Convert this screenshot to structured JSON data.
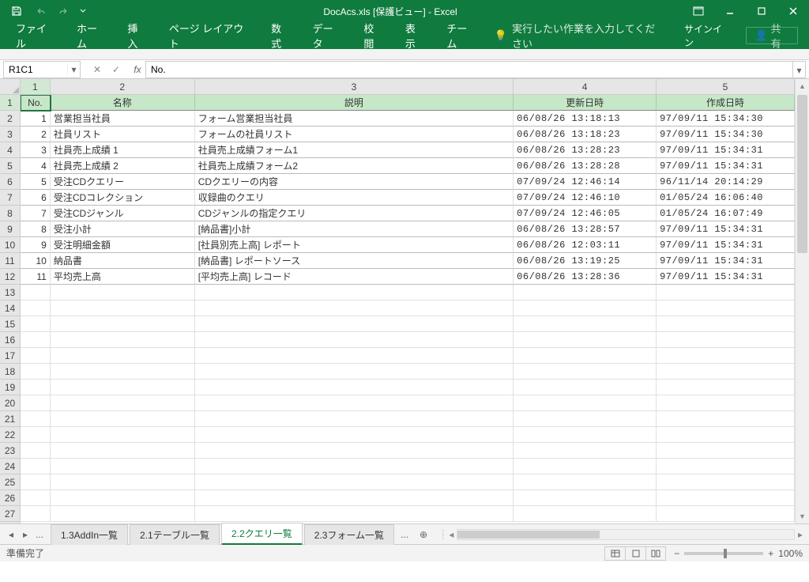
{
  "window": {
    "title": "DocAcs.xls  [保護ビュー] - Excel"
  },
  "ribbon": {
    "tabs": [
      "ファイル",
      "ホーム",
      "挿入",
      "ページ レイアウト",
      "数式",
      "データ",
      "校閲",
      "表示",
      "チーム"
    ],
    "tell_me": "実行したい作業を入力してください",
    "signin": "サインイン",
    "share": "共有"
  },
  "formula_bar": {
    "name_box": "R1C1",
    "formula": "No."
  },
  "columns": {
    "labels": [
      "1",
      "2",
      "3",
      "4",
      "5"
    ],
    "widths": [
      38,
      184,
      406,
      182,
      176
    ]
  },
  "headers": [
    "No.",
    "名称",
    "説明",
    "更新日時",
    "作成日時"
  ],
  "rows": [
    {
      "no": "1",
      "name": "営業担当社員",
      "desc": "フォーム営業担当社員",
      "upd": "06/08/26 13:18:13",
      "crt": "97/09/11 15:34:30"
    },
    {
      "no": "2",
      "name": "社員リスト",
      "desc": "フォームの社員リスト",
      "upd": "06/08/26 13:18:23",
      "crt": "97/09/11 15:34:30"
    },
    {
      "no": "3",
      "name": "社員売上成績 1",
      "desc": "社員売上成績フォーム1",
      "upd": "06/08/26 13:28:23",
      "crt": "97/09/11 15:34:31"
    },
    {
      "no": "4",
      "name": "社員売上成績 2",
      "desc": "社員売上成績フォーム2",
      "upd": "06/08/26 13:28:28",
      "crt": "97/09/11 15:34:31"
    },
    {
      "no": "5",
      "name": "受注CDクエリー",
      "desc": "CDクエリーの内容",
      "upd": "07/09/24 12:46:14",
      "crt": "96/11/14 20:14:29"
    },
    {
      "no": "6",
      "name": "受注CDコレクション",
      "desc": "収録曲のクエリ",
      "upd": "07/09/24 12:46:10",
      "crt": "01/05/24 16:06:40"
    },
    {
      "no": "7",
      "name": "受注CDジャンル",
      "desc": "CDジャンルの指定クエリ",
      "upd": "07/09/24 12:46:05",
      "crt": "01/05/24 16:07:49"
    },
    {
      "no": "8",
      "name": "受注小計",
      "desc": "[納品書]小計",
      "upd": "06/08/26 13:28:57",
      "crt": "97/09/11 15:34:31"
    },
    {
      "no": "9",
      "name": "受注明細金額",
      "desc": "[社員別売上高] レポート",
      "upd": "06/08/26 12:03:11",
      "crt": "97/09/11 15:34:31"
    },
    {
      "no": "10",
      "name": "納品書",
      "desc": "[納品書] レポートソース",
      "upd": "06/08/26 13:19:25",
      "crt": "97/09/11 15:34:31"
    },
    {
      "no": "11",
      "name": "平均売上高",
      "desc": "[平均売上高] レコード",
      "upd": "06/08/26 13:28:36",
      "crt": "97/09/11 15:34:31"
    }
  ],
  "empty_row_count": 15,
  "row_header_start": 1,
  "sheets": {
    "tabs": [
      "1.3AddIn一覧",
      "2.1テーブル一覧",
      "2.2クエリ一覧",
      "2.3フォーム一覧"
    ],
    "active_index": 2,
    "ellipsis_left": "...",
    "ellipsis_right": "...",
    "add": "⊕"
  },
  "status": {
    "ready": "準備完了",
    "zoom": "100%"
  }
}
